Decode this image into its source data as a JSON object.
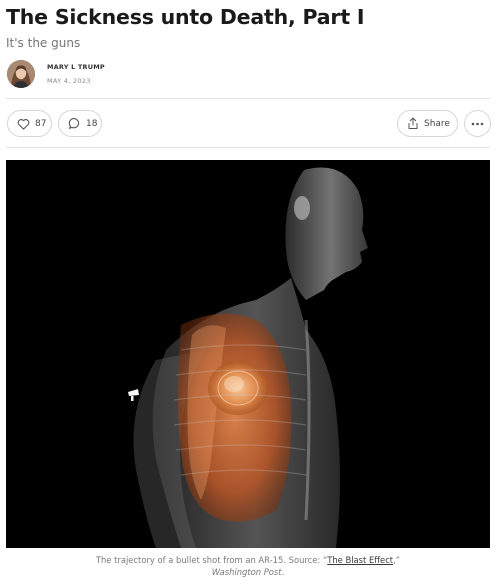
{
  "post": {
    "title": "The Sickness unto Death, Part I",
    "subtitle": "It's the guns",
    "author": "MARY L TRUMP",
    "date": "MAY 4, 2023"
  },
  "actions": {
    "likes": "87",
    "comments": "18",
    "share_label": "Share"
  },
  "icons": {
    "like": "heart-icon",
    "comment": "speech-bubble-icon",
    "share": "share-upload-icon",
    "more": "more-dots-icon"
  },
  "caption": {
    "prefix": "The trajectory of a bullet shot from an AR-15. Source: “",
    "link_text": "The Blast Effect",
    "suffix": ",”",
    "source": "Washington Post",
    "end": "."
  },
  "colors": {
    "text": "#1a1a1a",
    "muted": "#757575",
    "border": "#d6d6d6",
    "image_bg": "#000000",
    "organ_orange": "#e0682a"
  }
}
